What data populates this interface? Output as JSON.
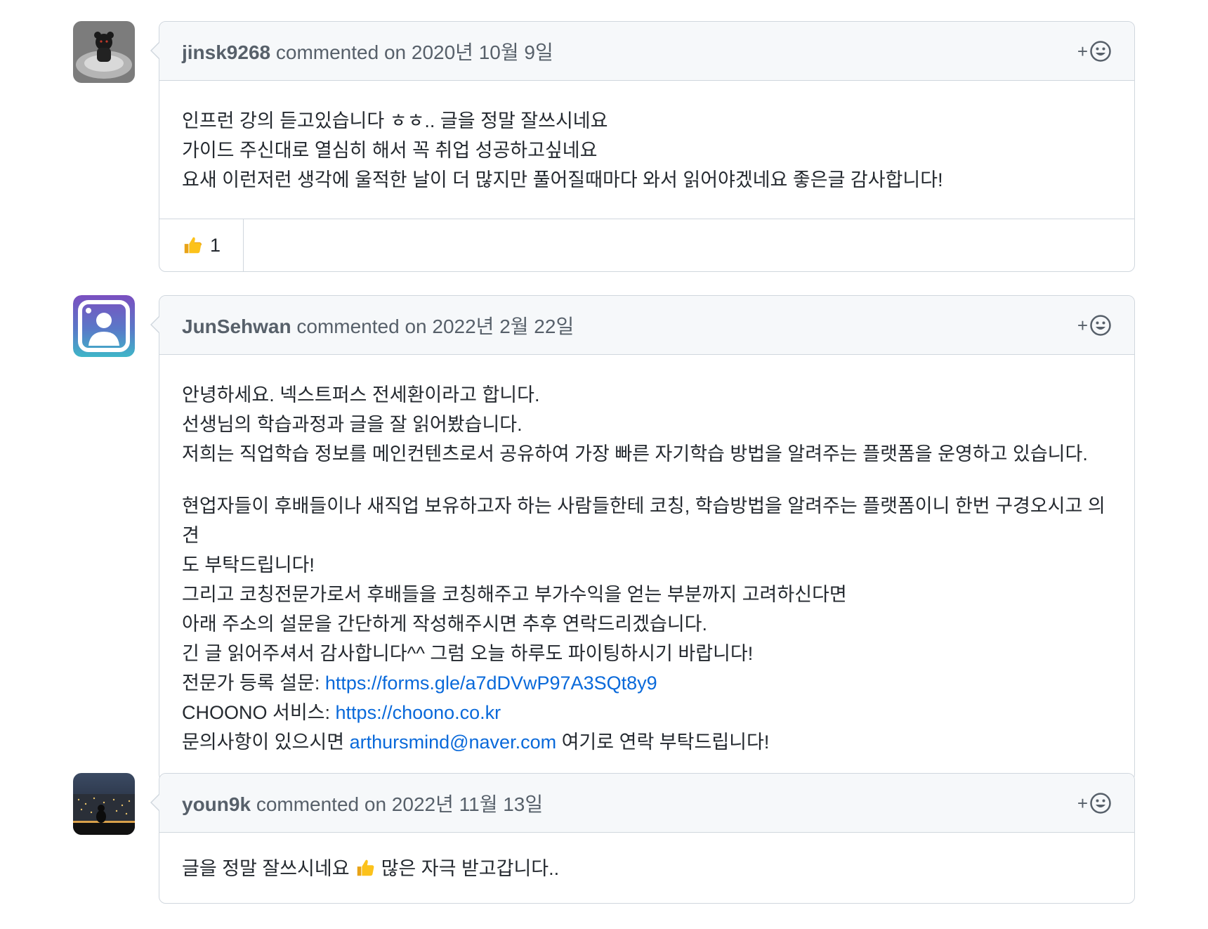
{
  "comments": [
    {
      "author": "jinsk9268",
      "meta": "commented on 2020년 10월 9일",
      "lines": [
        "인프런 강의 듣고있습니다 ㅎㅎ.. 글을 정말 잘쓰시네요",
        "가이드 주신대로 열심히 해서 꼭 취업 성공하고싶네요",
        "요새 이런저런 생각에 울적한 날이 더 많지만 풀어질때마다 와서 읽어야겠네요 좋은글 감사합니다!"
      ],
      "reactions": [
        {
          "icon": "thumbs-up-icon",
          "count": "1"
        }
      ]
    },
    {
      "author": "JunSehwan",
      "meta": "commented on 2022년 2월 22일",
      "paragraph1": [
        "안녕하세요. 넥스트퍼스 전세환이라고 합니다.",
        "선생님의 학습과정과 글을 잘 읽어봤습니다.",
        "저희는 직업학습 정보를 메인컨텐츠로서 공유하여 가장 빠른 자기학습 방법을 알려주는 플랫폼을 운영하고 있습니다."
      ],
      "paragraph2": [
        "현업자들이 후배들이나 새직업 보유하고자 하는 사람들한테 코칭, 학습방법을 알려주는 플랫폼이니 한번 구경오시고 의견",
        "도 부탁드립니다!",
        "그리고 코칭전문가로서 후배들을 코칭해주고 부가수익을 얻는 부분까지 고려하신다면",
        "아래 주소의 설문을 간단하게 작성해주시면 추후 연락드리겠습니다.",
        "긴 글 읽어주셔서 감사합니다^^ 그럼 오늘 하루도 파이팅하시기 바랍니다!"
      ],
      "survey_label": "전문가 등록 설문: ",
      "survey_link": "https://forms.gle/a7dDVwP97A3SQt8y9",
      "service_label": "CHOONO 서비스: ",
      "service_link": "https://choono.co.kr",
      "contact_prefix": "문의사항이 있으시면 ",
      "contact_email": "arthursmind@naver.com",
      "contact_suffix": " 여기로 연락 부탁드립니다!"
    },
    {
      "author": "youn9k",
      "meta": "commented on 2022년 11월 13일",
      "text_before": "글을 정말 잘쓰시네요 ",
      "text_after": " 많은 자극 받고갑니다.."
    }
  ],
  "reaction_button": {
    "plus": "+",
    "icon": "smiley-icon"
  },
  "colors": {
    "link": "#0969da",
    "header_bg": "#f6f8fa",
    "border": "#d0d7de",
    "muted": "#57606a"
  }
}
